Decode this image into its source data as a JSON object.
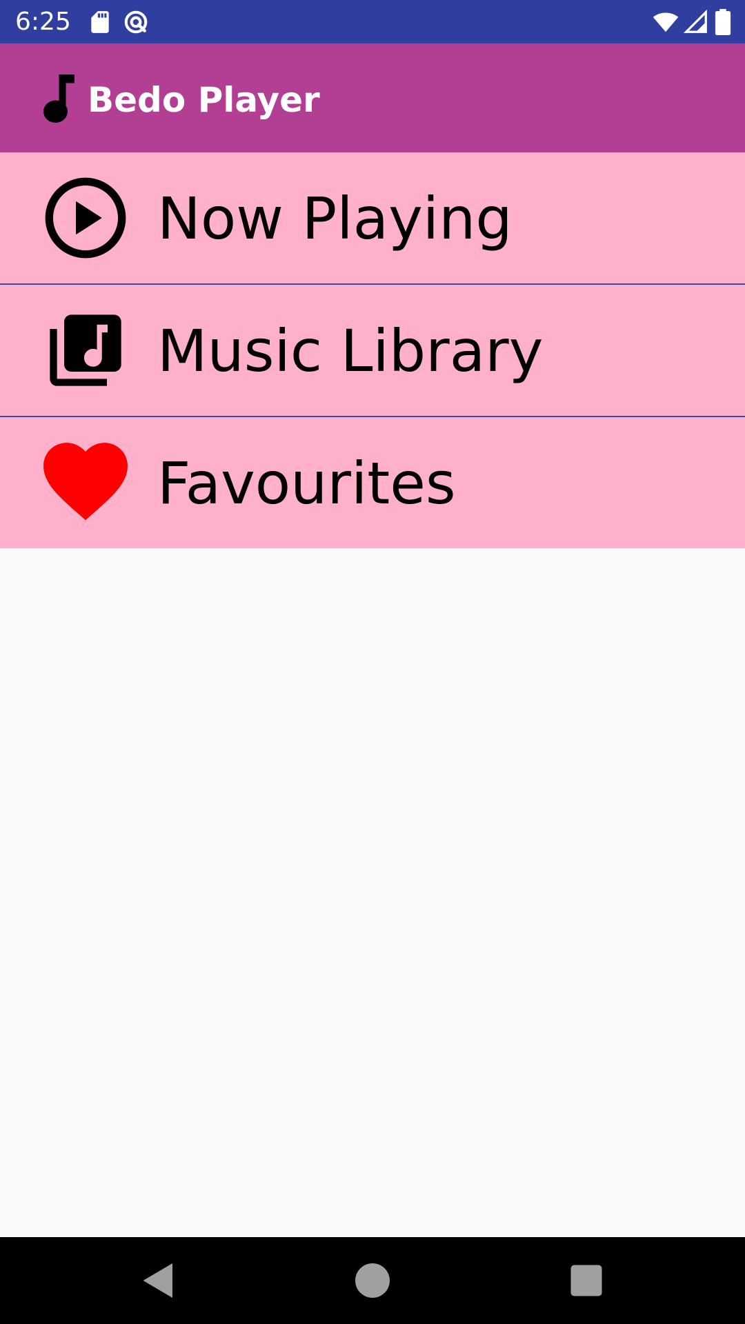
{
  "status_bar": {
    "time": "6:25",
    "icons_left": [
      "sd-card-icon",
      "sync-icon"
    ],
    "icons_right": [
      "wifi-icon",
      "cell-signal-icon",
      "battery-icon"
    ],
    "background": "#303f9f"
  },
  "app_bar": {
    "title": "Bedo Player",
    "logo_icon": "music-note-icon",
    "background": "#b33f94"
  },
  "menu": {
    "background": "#ffb0cb",
    "divider_color": "#3949ab",
    "items": [
      {
        "label": "Now Playing",
        "icon": "play-circle-icon"
      },
      {
        "label": "Music Library",
        "icon": "music-library-icon"
      },
      {
        "label": "Favourites",
        "icon": "heart-icon",
        "icon_color": "#ff0000"
      }
    ]
  },
  "nav_bar": {
    "buttons": [
      "back-icon",
      "home-icon",
      "recents-icon"
    ]
  }
}
